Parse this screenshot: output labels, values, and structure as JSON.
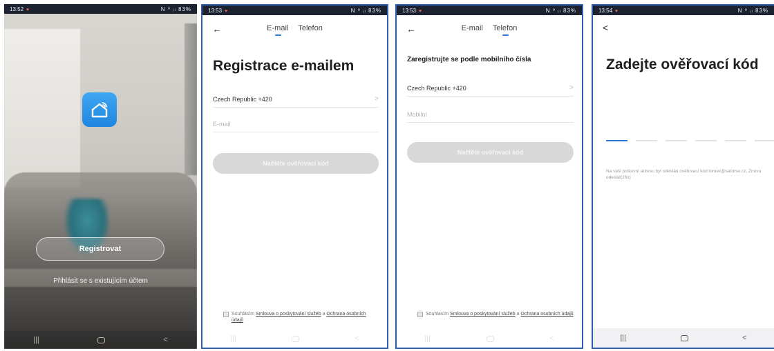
{
  "phone1": {
    "status": {
      "time": "13:52",
      "signal": "N ⁰ ᵢₗ 83%"
    },
    "register_label": "Registrovat",
    "login_label": "Přihlásit se s existujícím účtem",
    "nav": {
      "recents": "|||",
      "back": "<"
    }
  },
  "phone2": {
    "status": {
      "time": "13:53",
      "signal": "N ⁰ ᵢₗ 83%"
    },
    "back_label": "←",
    "tabs": [
      {
        "label": "E-mail",
        "active": true
      },
      {
        "label": "Telefon",
        "active": false
      }
    ],
    "title": "Registrace e-mailem",
    "country": "Czech Republic +420",
    "email_placeholder": "E-mail",
    "code_button": "Načtěte ověřovací kód",
    "consent": {
      "prefix": "Souhlasím",
      "terms": "Smlouva o poskytování služeb",
      "joiner": "a",
      "privacy": "Ochrana osobních údajů"
    }
  },
  "phone3": {
    "status": {
      "time": "13:53",
      "signal": "N ⁰ ᵢₗ 83%"
    },
    "back_label": "←",
    "tabs": [
      {
        "label": "E-mail",
        "active": false
      },
      {
        "label": "Telefon",
        "active": true
      }
    ],
    "title": "Zaregistrujte se podle mobilního čísla",
    "country": "Czech Republic +420",
    "mobile_placeholder": "Mobilní",
    "code_button": "Načtěte ověřovací kód",
    "consent": {
      "prefix": "Souhlasím",
      "terms": "Smlouva o poskytování služeb",
      "joiner": "a",
      "privacy": "Ochrana osobních údajů"
    }
  },
  "phone4": {
    "status": {
      "time": "13:54",
      "signal": "N ⁰ ᵢₗ 83%"
    },
    "back_label": "<",
    "title": "Zadejte ověřovací kód",
    "code_length": 6,
    "note": "Na vaši poštovní adresu byl odeslán ověřovací kód tomek@satorse.cz, Znovu odeslat(26s)",
    "nav": {
      "recents": "|||",
      "back": "<"
    }
  },
  "colors": {
    "frame": "#2f5fae",
    "accent": "#2a74d8",
    "logo": "#1f86e0",
    "button_disabled": "#d8d8d8"
  },
  "icons": {
    "logo": "smart-home-icon",
    "back": "arrow-left-icon",
    "chevron": "chevron-right-icon",
    "home": "home-square-icon"
  }
}
